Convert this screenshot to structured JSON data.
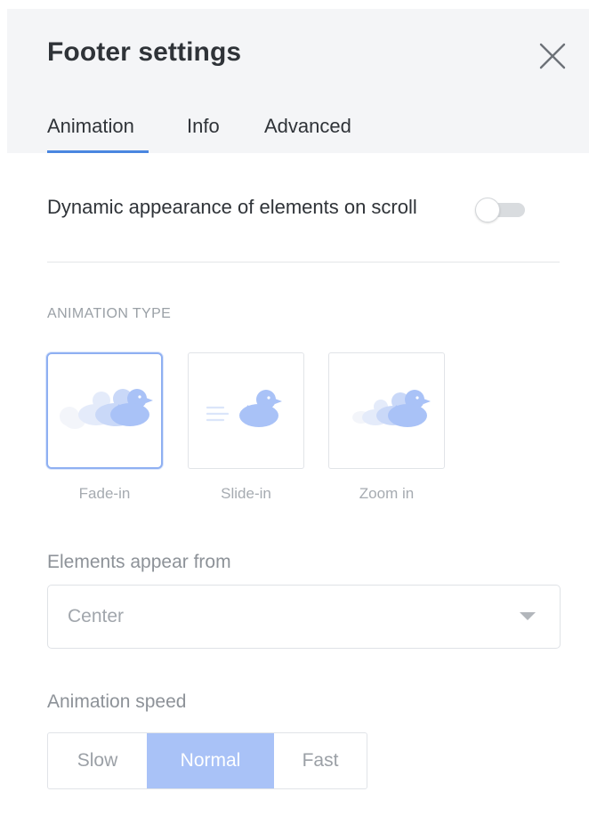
{
  "header": {
    "title": "Footer settings",
    "close_icon": "close-icon"
  },
  "tabs": [
    {
      "label": "Animation",
      "active": true
    },
    {
      "label": "Info",
      "active": false
    },
    {
      "label": "Advanced",
      "active": false
    }
  ],
  "scroll_animation": {
    "label": "Dynamic appearance of elements on scroll",
    "enabled": false
  },
  "animation_type": {
    "section_label": "ANIMATION TYPE",
    "options": [
      {
        "label": "Fade-in",
        "icon": "fade-in-duck-icon",
        "selected": true
      },
      {
        "label": "Slide-in",
        "icon": "slide-in-duck-icon",
        "selected": false
      },
      {
        "label": "Zoom in",
        "icon": "zoom-in-duck-icon",
        "selected": false
      }
    ]
  },
  "appear_from": {
    "label": "Elements appear from",
    "value": "Center"
  },
  "speed": {
    "label": "Animation speed",
    "options": [
      "Slow",
      "Normal",
      "Fast"
    ],
    "selected": "Normal"
  },
  "colors": {
    "accent": "#4a86e0",
    "selected_segment": "#a9c2f7",
    "card_selected_border": "#8fb0f2",
    "duck_primary": "#a9c2f7",
    "header_bg": "#f4f5f7"
  }
}
